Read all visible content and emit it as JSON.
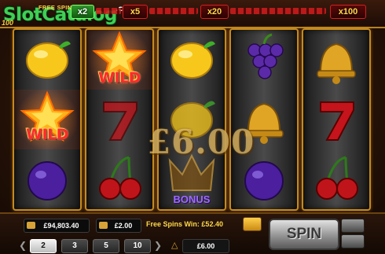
{
  "watermark": {
    "brand": "SlotCatalog",
    "suffix": ".com"
  },
  "header": {
    "free_spins_label": "FREE SPINS",
    "multipliers": [
      "x2",
      "x5",
      "x20",
      "x100"
    ],
    "active_multiplier": "x2",
    "sticker": "100"
  },
  "reels": [
    [
      "lemon",
      "wild",
      "plum"
    ],
    [
      "wild",
      "seven",
      "cherries"
    ],
    [
      "lemon",
      "lemon",
      "bonus"
    ],
    [
      "grapes",
      "bell",
      "plum"
    ],
    [
      "bell",
      "seven",
      "cherries"
    ]
  ],
  "symbol_labels": {
    "wild": "WILD",
    "bonus": "BONUS"
  },
  "win_overlay": "£6.00",
  "footer": {
    "balance": "£94,803.40",
    "bet": "£2.00",
    "free_spins_win_label": "Free Spins Win: £52.40",
    "stakes": [
      "2",
      "3",
      "5",
      "10"
    ],
    "selected_stake": "2",
    "total_bet": "£6.00",
    "spin_label": "SPIN"
  },
  "colors": {
    "reel_frame": "#c68a1c",
    "active_multiplier": "#2f9a2a",
    "wild_text": "#ff2a2a",
    "highlight": "#ffd84a"
  }
}
